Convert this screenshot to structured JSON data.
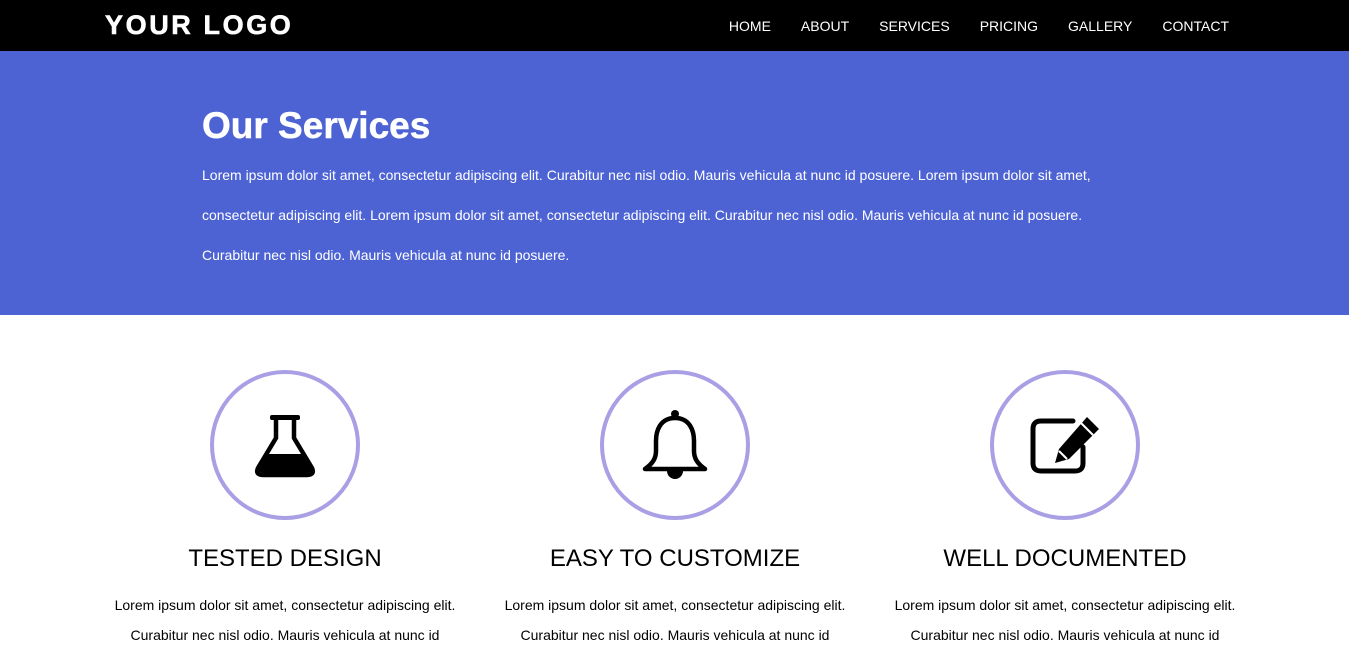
{
  "header": {
    "logo": "YOUR LOGO",
    "nav": [
      "HOME",
      "ABOUT",
      "SERVICES",
      "PRICING",
      "GALLERY",
      "CONTACT"
    ]
  },
  "hero": {
    "title": "Our Services",
    "text": "Lorem ipsum dolor sit amet, consectetur adipiscing elit. Curabitur nec nisl odio. Mauris vehicula at nunc id posuere. Lorem ipsum dolor sit amet, consectetur adipiscing elit. Lorem ipsum dolor sit amet, consectetur adipiscing elit. Curabitur nec nisl odio. Mauris vehicula at nunc id posuere. Curabitur nec nisl odio. Mauris vehicula at nunc id posuere."
  },
  "features": [
    {
      "icon": "flask-icon",
      "title": "TESTED DESIGN",
      "text": "Lorem ipsum dolor sit amet, consectetur adipiscing elit. Curabitur nec nisl odio. Mauris vehicula at nunc id"
    },
    {
      "icon": "bell-icon",
      "title": "EASY TO CUSTOMIZE",
      "text": "Lorem ipsum dolor sit amet, consectetur adipiscing elit. Curabitur nec nisl odio. Mauris vehicula at nunc id"
    },
    {
      "icon": "edit-icon",
      "title": "WELL DOCUMENTED",
      "text": "Lorem ipsum dolor sit amet, consectetur adipiscing elit. Curabitur nec nisl odio. Mauris vehicula at nunc id"
    }
  ],
  "colors": {
    "header_bg": "#000000",
    "hero_bg": "#4d63d4",
    "circle_border": "#a99fe4"
  }
}
